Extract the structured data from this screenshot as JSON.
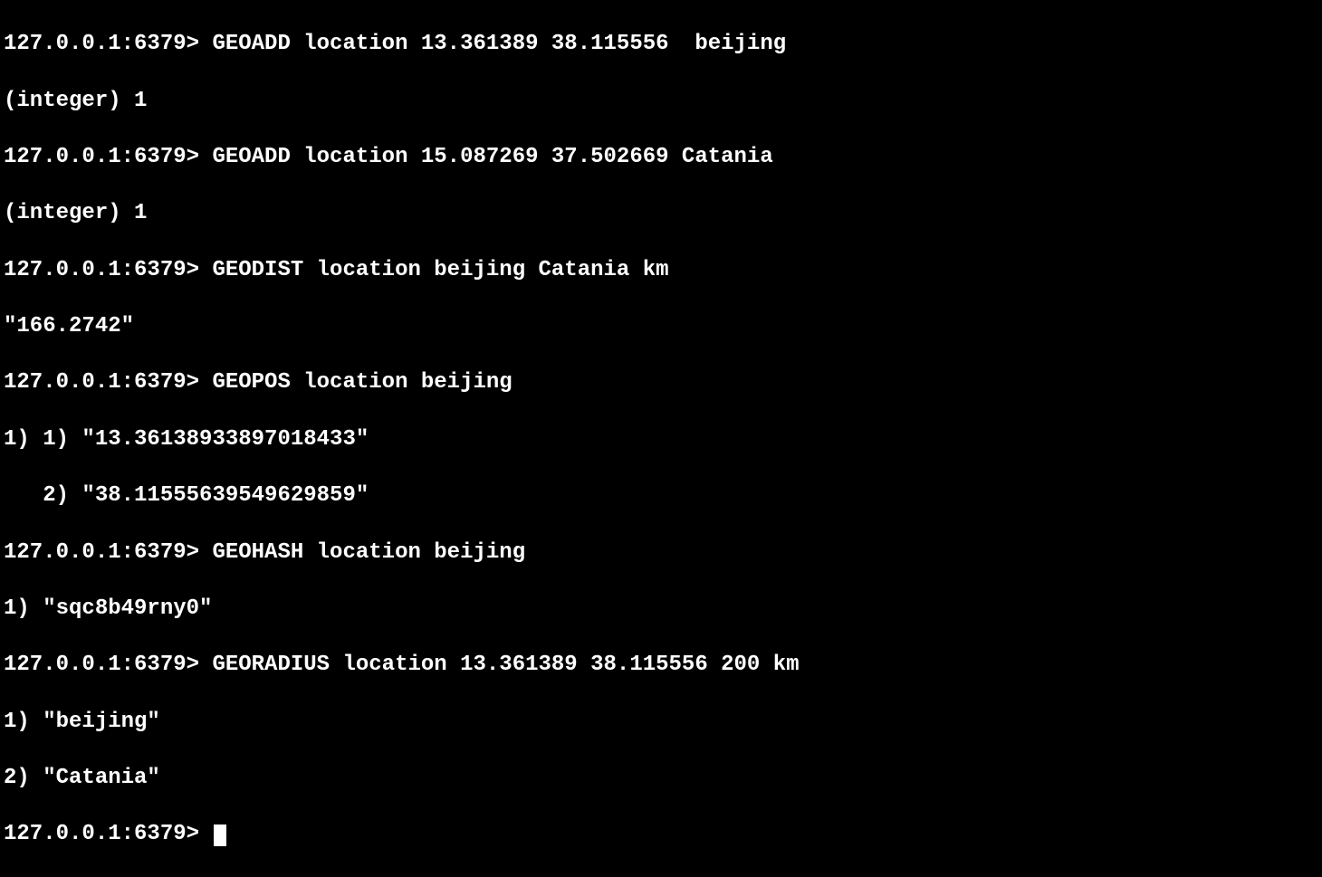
{
  "terminal": {
    "prompt": "127.0.0.1:6379> ",
    "lines": [
      {
        "prompt": "127.0.0.1:6379> ",
        "command": "GEOADD location 13.361389 38.115556  beijing"
      },
      {
        "output": "(integer) 1"
      },
      {
        "prompt": "127.0.0.1:6379> ",
        "command": "GEOADD location 15.087269 37.502669 Catania"
      },
      {
        "output": "(integer) 1"
      },
      {
        "prompt": "127.0.0.1:6379> ",
        "command": "GEODIST location beijing Catania km"
      },
      {
        "output": "\"166.2742\""
      },
      {
        "prompt": "127.0.0.1:6379> ",
        "command": "GEOPOS location beijing"
      },
      {
        "output": "1) 1) \"13.36138933897018433\""
      },
      {
        "output": "   2) \"38.11555639549629859\""
      },
      {
        "prompt": "127.0.0.1:6379> ",
        "command": "GEOHASH location beijing"
      },
      {
        "output": "1) \"sqc8b49rny0\""
      },
      {
        "prompt": "127.0.0.1:6379> ",
        "command": "GEORADIUS location 13.361389 38.115556 200 km"
      },
      {
        "output": "1) \"beijing\""
      },
      {
        "output": "2) \"Catania\""
      },
      {
        "prompt": "127.0.0.1:6379> ",
        "cursor": true
      }
    ]
  }
}
